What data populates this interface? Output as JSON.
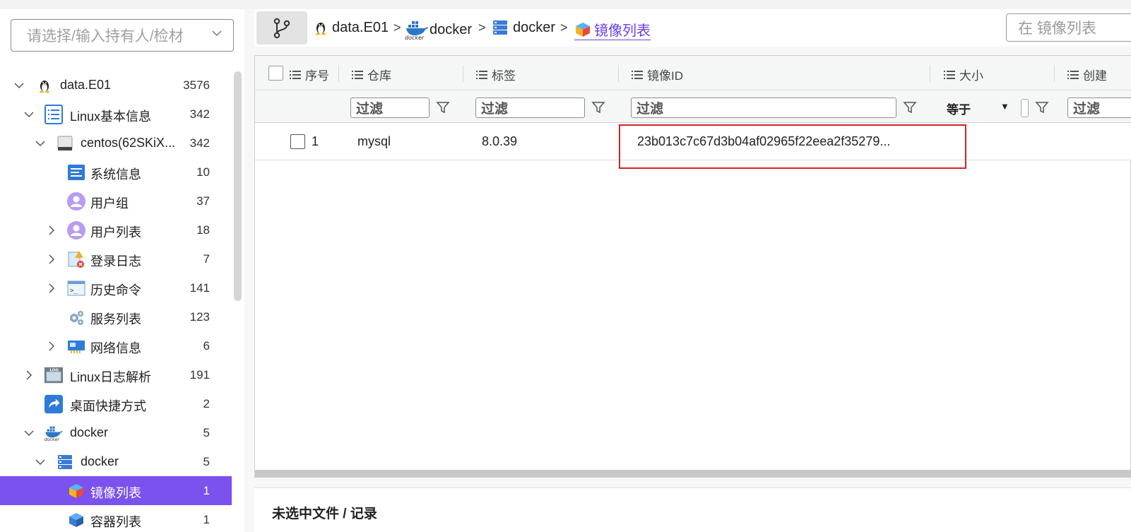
{
  "sidebar": {
    "owner_placeholder": "请选择/输入持有人/检材",
    "tree": [
      {
        "label": "data.E01",
        "count": "3576",
        "icon": "linux-penguin-icon",
        "level": 0,
        "expander": "expanded"
      },
      {
        "label": "Linux基本信息",
        "count": "342",
        "icon": "list-document-icon",
        "level": 1,
        "expander": "expanded"
      },
      {
        "label": "centos(62SKiX...",
        "count": "342",
        "icon": "hard-disk-icon",
        "level": 2,
        "expander": "expanded"
      },
      {
        "label": "系统信息",
        "count": "10",
        "icon": "system-info-icon",
        "level": 3,
        "expander": "none"
      },
      {
        "label": "用户组",
        "count": "37",
        "icon": "user-group-icon",
        "level": 3,
        "expander": "none"
      },
      {
        "label": "用户列表",
        "count": "18",
        "icon": "user-icon",
        "level": 3,
        "expander": "collapsed"
      },
      {
        "label": "登录日志",
        "count": "7",
        "icon": "login-log-icon",
        "level": 3,
        "expander": "collapsed"
      },
      {
        "label": "历史命令",
        "count": "141",
        "icon": "terminal-icon",
        "level": 3,
        "expander": "collapsed"
      },
      {
        "label": "服务列表",
        "count": "123",
        "icon": "gear-icon",
        "level": 3,
        "expander": "none"
      },
      {
        "label": "网络信息",
        "count": "6",
        "icon": "network-card-icon",
        "level": 3,
        "expander": "collapsed"
      },
      {
        "label": "Linux日志解析",
        "count": "191",
        "icon": "log-file-icon",
        "level": 1,
        "expander": "collapsed"
      },
      {
        "label": "桌面快捷方式",
        "count": "2",
        "icon": "shortcut-icon",
        "level": 1,
        "expander": "none"
      },
      {
        "label": "docker",
        "count": "5",
        "icon": "docker-icon",
        "level": 1,
        "expander": "expanded"
      },
      {
        "label": "docker",
        "count": "5",
        "icon": "server-icon",
        "level": 2,
        "expander": "expanded"
      },
      {
        "label": "镜像列表",
        "count": "1",
        "icon": "image-cube-icon",
        "level": 3,
        "expander": "none",
        "selected": true
      },
      {
        "label": "容器列表",
        "count": "1",
        "icon": "container-icon",
        "level": 3,
        "expander": "none"
      }
    ]
  },
  "breadcrumb": {
    "items": [
      {
        "label": "data.E01",
        "icon": "linux-penguin-icon"
      },
      {
        "label": "docker",
        "icon": "docker-icon"
      },
      {
        "label": "docker",
        "icon": "server-icon"
      },
      {
        "label": "镜像列表",
        "icon": "image-cube-icon"
      }
    ],
    "separator": ">"
  },
  "search": {
    "placeholder": "在 镜像列表"
  },
  "grid": {
    "columns": [
      "序号",
      "仓库",
      "标签",
      "镜像ID",
      "大小",
      "创建"
    ],
    "filter_placeholder": "过滤",
    "size_filter_operator": "等于",
    "rows": [
      {
        "index": "1",
        "repo": "mysql",
        "tag": "8.0.39",
        "image_id": "23b013c7c67d3b04af02965f22eea2f35279..."
      }
    ]
  },
  "bottom_panel": {
    "text": "未选中文件 / 记录"
  },
  "colors": {
    "accent": "#7b52ee",
    "highlight": "#d4202a"
  }
}
